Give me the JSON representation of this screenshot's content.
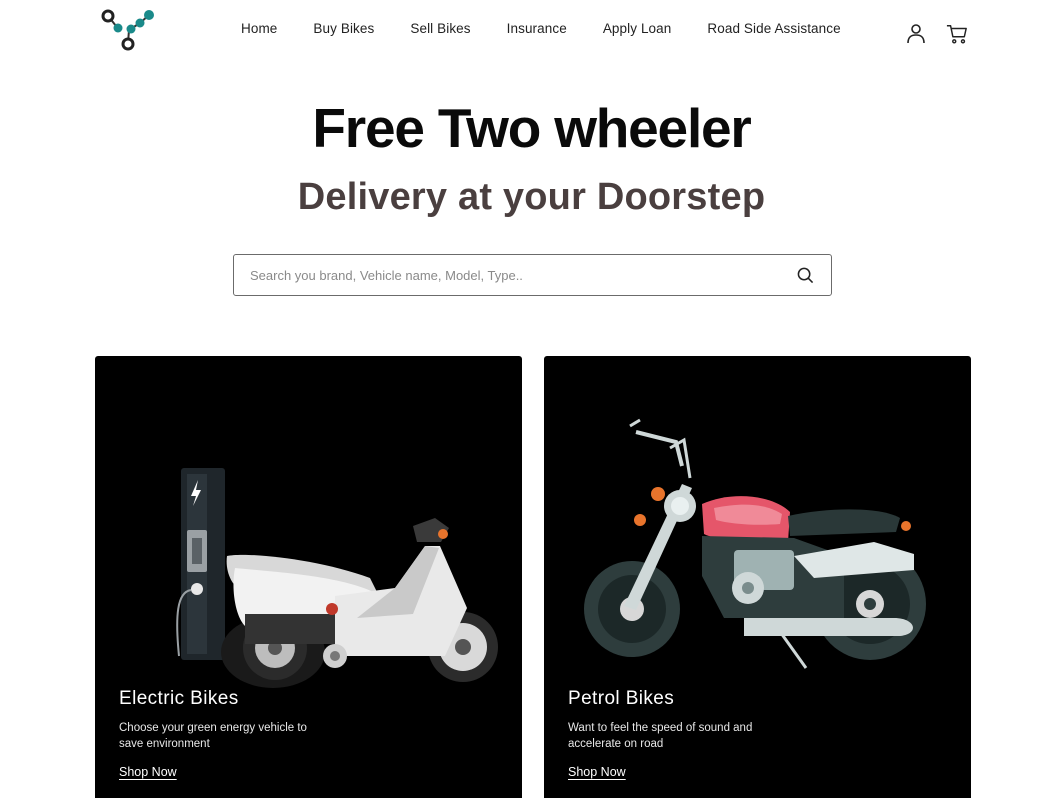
{
  "header": {
    "logo_icon": "molecule-logo-icon",
    "nav": [
      {
        "label": "Home"
      },
      {
        "label": "Buy Bikes"
      },
      {
        "label": "Sell Bikes"
      },
      {
        "label": "Insurance"
      },
      {
        "label": "Apply Loan"
      },
      {
        "label": "Road Side Assistance"
      }
    ],
    "user_icon": "user-icon",
    "cart_icon": "cart-icon",
    "logo_color": "#1a8a8a"
  },
  "hero": {
    "title": "Free Two wheeler",
    "subtitle": "Delivery at your Doorstep"
  },
  "search": {
    "placeholder": "Search you brand, Vehicle name, Model, Type..",
    "value": "",
    "icon": "search-icon"
  },
  "cards": [
    {
      "title": "Electric Bikes",
      "description": "Choose your green energy vehicle to save environment",
      "link": "Shop Now",
      "image_icon": "electric-scooter-illustration"
    },
    {
      "title": "Petrol Bikes",
      "description": "Want to feel the speed of sound and accelerate on road",
      "link": "Shop Now",
      "image_icon": "motorcycle-illustration"
    }
  ]
}
